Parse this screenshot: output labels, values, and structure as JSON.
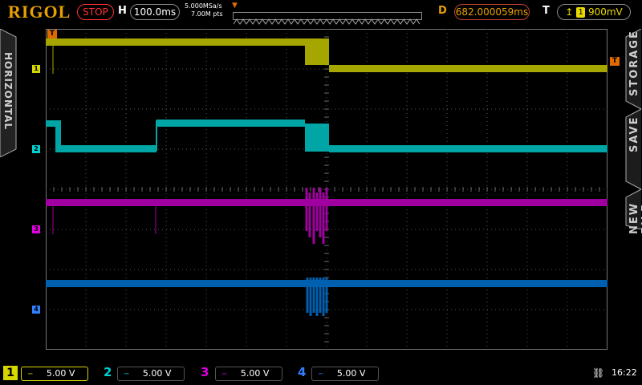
{
  "brand": "RIGOL",
  "run_state": "STOP",
  "horizontal": {
    "label": "H",
    "timebase": "100.0ms",
    "sample_rate": "5.000MSa/s",
    "memory_depth": "7.00M pts"
  },
  "delay": {
    "label": "D",
    "value": "682.000059ms"
  },
  "trigger": {
    "label": "T",
    "source": "1",
    "level": "900mV",
    "edge_icon": "rising-edge-icon",
    "marker": "T"
  },
  "side_left": {
    "title": "HORIZONTAL"
  },
  "side_right": {
    "items": [
      "STORAGE",
      "SAVE",
      "NEW FILE"
    ]
  },
  "channels": [
    {
      "num": "1",
      "scale": "5.00 V",
      "coupling": "dc",
      "color": "#d6d600"
    },
    {
      "num": "2",
      "scale": "5.00 V",
      "coupling": "dc",
      "color": "#00d0d0"
    },
    {
      "num": "3",
      "scale": "5.00 V",
      "coupling": "dc",
      "color": "#e000e0"
    },
    {
      "num": "4",
      "scale": "5.00 V",
      "coupling": "dc",
      "color": "#3080ff"
    }
  ],
  "status": {
    "usb_icon": "usb-icon",
    "time": "16:22"
  },
  "waveform_colors": {
    "ch1": "#a6a600",
    "ch2": "#00a6a6",
    "ch3": "#a000a0",
    "ch4": "#0060b0"
  }
}
